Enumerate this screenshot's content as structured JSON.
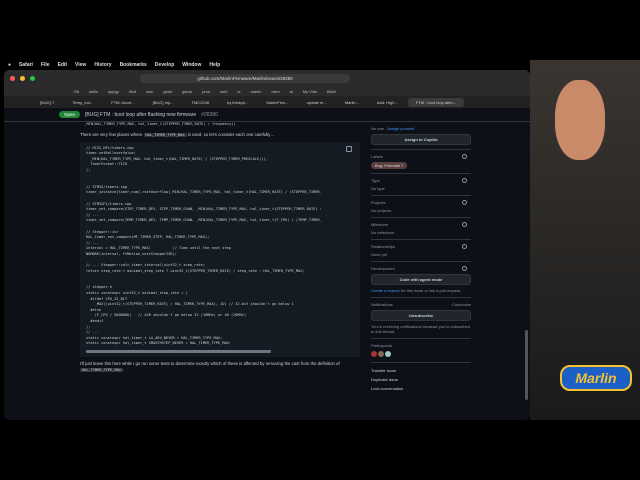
{
  "menubar": [
    "Safari",
    "File",
    "Edit",
    "View",
    "History",
    "Bookmarks",
    "Develop",
    "Window",
    "Help"
  ],
  "url": "github.com/MarlinFirmware/Marlin/issues/28280",
  "favorites": [
    "Git",
    "skills",
    "appgp",
    "ifixit",
    "mac",
    "geek",
    "game",
    "prod",
    "web",
    "tv",
    "marlin",
    "retro",
    "ai",
    "My Vids",
    "Bibel"
  ],
  "tabs": [
    "[BUG] T",
    "Temp_bot...",
    "FTM: Accel...",
    "[BUG] Inp...",
    "TMC2208",
    "by thinkyh...",
    "MarlinFirm...",
    "update m...",
    "Marlin...",
    "Add: High...",
    "FTM : boot loop after..."
  ],
  "issue": {
    "status": "Open",
    "title": "[BUG] FTM : boot loop after flashing new firmware",
    "number": "#28280"
  },
  "main": {
    "code0": "  _MIN(HAL_TIMER_TYPE_MAX, hal_timer_t(STEPPER_TIMER_RATE) / frequency))",
    "para1a": "There are very few places where",
    "para1code": "HAL_TIMER_TYPE_MAX",
    "para1b": "is used, so let's consider each one carefully…",
    "code1": "// HC32_HPL/timers.cpp\ntimer.setRolloverValue(\n  _MIN(HAL_TIMER_TYPE_MAX, hal_timer_t(HAL_TIMER_RATE) / (STEPPER_TIMER_PRESCALE))),\n  TimerFormat::TICK\n);\n\n\n// STM32/timers.cpp\ntimer_instance[timer_num]->setOverflow(_MIN(HAL_TIMER_TYPE_MAX, hal_timer_t(HAL_TIMER_RATE) / (STEPPER_TIMER_\n\n// STM32F1/timers.cpp\ntimer_set_compare(STEP_TIMER_DEV, STEP_TIMER_CHAN, _MIN(HAL_TIMER_TYPE_MAX, hal_timer_t(STEPPER_TIMER_RATE) :\n// ...\ntimer_set_compare(TEMP_TIMER_DEV, TEMP_TIMER_CHAN, _MIN(HAL_TIMER_TYPE_MAX, hal_timer_t(F_CPU) / (TEMP_TIMER_\n\n// Stepper::isr\nHAL_timer_set_compare(MF_TIMER_STEP, HAL_TIMER_TYPE_MAX);\n// ...\ninterval = HAL_TIMER_TYPE_MAX;          // Time until the next step\nNOMORE(interval, ftMotion_nextStepperISR);\n\n// ... Stepper::calc_timer_interval(uint32_t step_rate)\nreturn step_rate > minimal_step_rate ? uint32_t(STEPPER_TIMER_RATE) / step_rate : HAL_TIMER_TYPE_MAX;\n\n\n// stepper.h\nstatic constexpr uint32_t minimal_step_rate = (\n  #ifdef CPU_32_BIT\n    _MAX((uint32_t(STEPPER_TIMER_RATE) / HAL_TIMER_TYPE_MAX), 1U) // 32-bit shouldn't go below 1\n  #else\n    (F_CPU / 500000U)   // AVR shouldn't go below 32 (16MHz) or 40 (20MHz)\n  #endif\n);\n// ...\nstatic constexpr hal_timer_t LA_ADV_NEVER = HAL_TIMER_TYPE_MAX;\nstatic constexpr hal_timer_t SMOOTHSTEP_NEVER = HAL_TIMER_TYPE_MAX;",
    "para2a": "I'll just leave this here while I go run some tests to determine exactly which of these is affected by removing the cast from the definition of",
    "para2code": "HAL_TIMER_TYPE_MAX",
    "para2b": "."
  },
  "sidebar": {
    "assignees": "No one -",
    "assign_self": "Assign yourself",
    "assign_copilot": "Assign to Copilot",
    "labels_h": "Labels",
    "label": "Bug: Potential ?",
    "type_h": "Type",
    "type_v": "No type",
    "projects_h": "Projects",
    "projects_v": "No projects",
    "milestone_h": "Milestone",
    "milestone_v": "No milestone",
    "rel_h": "Relationships",
    "rel_v": "None yet",
    "dev_h": "Development",
    "dev_btn": "Code with agent mode",
    "branch_link": "Create a branch",
    "branch_text": "for this issue or link a pull request.",
    "notif_h": "Notifications",
    "customize": "Customize",
    "unsub": "Unsubscribe",
    "notif_text": "You're receiving notifications because you're subscribed to this thread.",
    "participants_h": "Participants",
    "actions": [
      "Transfer issue",
      "Duplicate issue",
      "Lock conversation"
    ]
  },
  "logo": "Marlin"
}
